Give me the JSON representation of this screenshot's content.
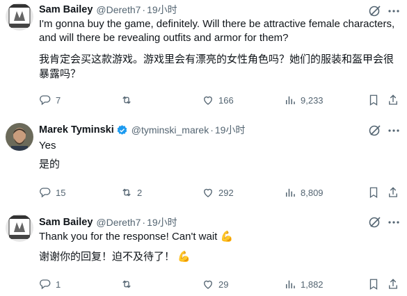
{
  "colors": {
    "text": "#0f1419",
    "muted": "#536471",
    "verified": "#1d9bf0",
    "divider": "#eff3f4"
  },
  "tweets": [
    {
      "name": "Sam Bailey",
      "handle": "@Dereth7",
      "separator": "·",
      "time": "19小时",
      "verified": false,
      "text_en": "I'm gonna buy the game, definitely. Will there be attractive female characters, and will there be revealing outfits and armor for them?",
      "text_zh": "我肯定会买这款游戏。游戏里会有漂亮的女性角色吗？她们的服装和盔甲会很暴露吗？",
      "replies": "7",
      "reposts": "",
      "likes": "166",
      "views": "9,233"
    },
    {
      "name": "Marek Tyminski",
      "handle": "@tyminski_marek",
      "separator": "·",
      "time": "19小时",
      "verified": true,
      "text_en": "Yes",
      "text_zh": "是的",
      "replies": "15",
      "reposts": "2",
      "likes": "292",
      "views": "8,809"
    },
    {
      "name": "Sam Bailey",
      "handle": "@Dereth7",
      "separator": "·",
      "time": "19小时",
      "verified": false,
      "text_en": "Thank you for the response! Can't wait 💪",
      "text_zh": "谢谢你的回复！迫不及待了！ 💪",
      "replies": "1",
      "reposts": "",
      "likes": "29",
      "views": "1,882"
    }
  ],
  "icons": [
    "reply-icon",
    "repost-icon",
    "like-icon",
    "views-icon",
    "bookmark-icon",
    "share-icon",
    "grok-icon",
    "more-icon",
    "verified-badge-icon"
  ]
}
